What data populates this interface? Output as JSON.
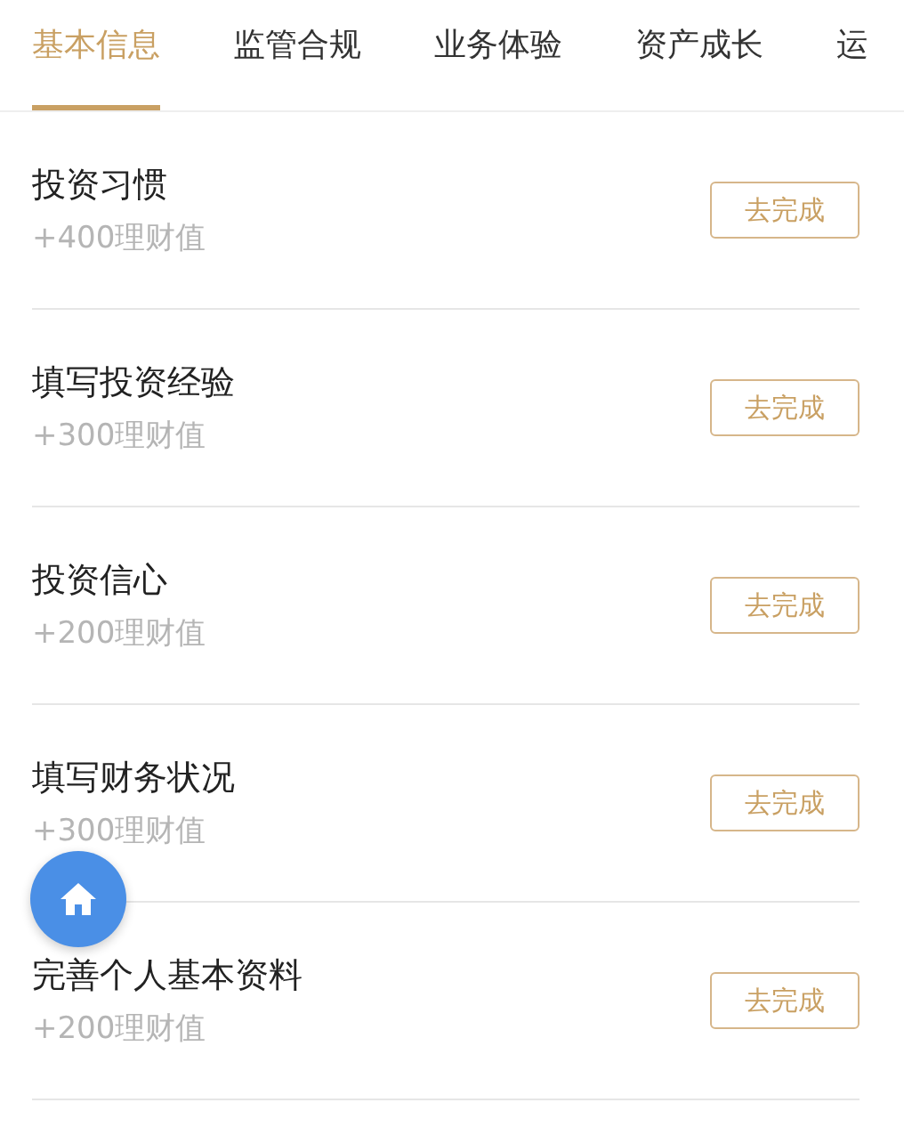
{
  "tabs": [
    {
      "label": "基本信息",
      "selected": true
    },
    {
      "label": "监管合规",
      "selected": false
    },
    {
      "label": "业务体验",
      "selected": false
    },
    {
      "label": "资产成长",
      "selected": false
    },
    {
      "label": "运",
      "selected": false
    }
  ],
  "tasks": [
    {
      "title": "投资习惯",
      "reward": "+400理财值",
      "action": "去完成"
    },
    {
      "title": "填写投资经验",
      "reward": "+300理财值",
      "action": "去完成"
    },
    {
      "title": "投资信心",
      "reward": "+200理财值",
      "action": "去完成"
    },
    {
      "title": "填写财务状况",
      "reward": "+300理财值",
      "action": "去完成"
    },
    {
      "title": "完善个人基本资料",
      "reward": "+200理财值",
      "action": "去完成"
    }
  ]
}
